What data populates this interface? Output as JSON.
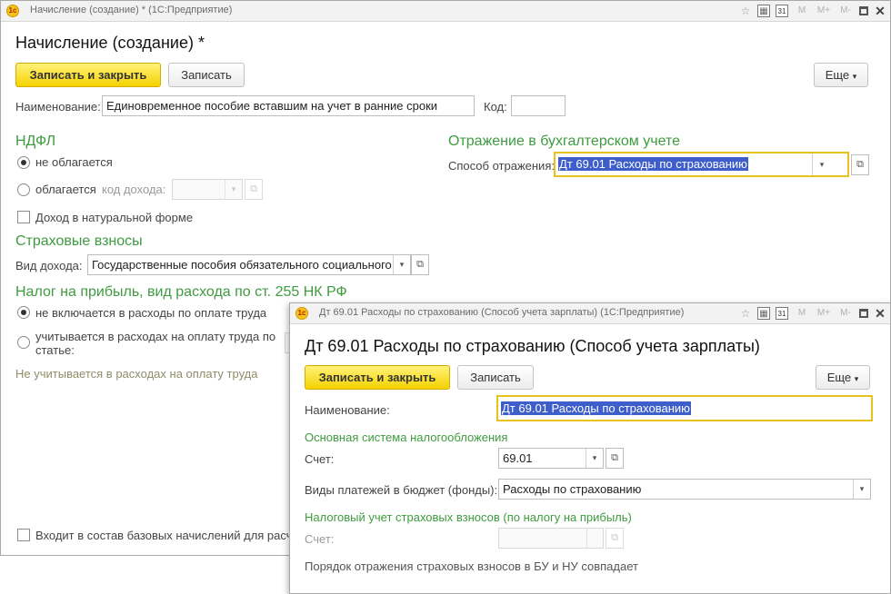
{
  "main": {
    "window_title": "Начисление (создание) * (1С:Предприятие)",
    "form_title": "Начисление (создание) *",
    "btn_save_close": "Записать и закрыть",
    "btn_save": "Записать",
    "btn_more": "Еще",
    "name_label": "Наименование:",
    "name_value": "Единовременное пособие вставшим на учет в ранние сроки",
    "code_label": "Код:",
    "code_value": "",
    "ndfl_title": "НДФЛ",
    "ndfl_opt1": "не облагается",
    "ndfl_opt2": "облагается",
    "income_code_label": "код дохода:",
    "natural_form": "Доход в натуральной форме",
    "acc_title": "Отражение в бухгалтерском учете",
    "acc_method_label": "Способ отражения:",
    "acc_method_value": "Дт 69.01 Расходы по страхованию",
    "ins_title": "Страховые взносы",
    "income_type_label": "Вид дохода:",
    "income_type_value": "Государственные пособия обязательного социального",
    "profit_title": "Налог на прибыль, вид расхода по ст. 255 НК РФ",
    "profit_opt1": "не включается в расходы по оплате труда",
    "profit_opt2_line1": "учитывается в расходах на оплату труда по",
    "profit_opt2_line2": "статье:",
    "profit_note": "Не учитывается в расходах на оплату труда",
    "base_accruals": "Входит в состав базовых начислений для расч"
  },
  "popup": {
    "window_title": "Дт 69.01 Расходы по страхованию (Способ учета зарплаты)  (1С:Предприятие)",
    "form_title": "Дт 69.01 Расходы по страхованию (Способ учета зарплаты)",
    "btn_save_close": "Записать и закрыть",
    "btn_save": "Записать",
    "btn_more": "Еще",
    "name_label": "Наименование:",
    "name_value": "Дт 69.01 Расходы по страхованию",
    "main_tax_title": "Основная система налогообложения",
    "account_label": "Счет:",
    "account_value": "69.01",
    "budget_label": "Виды платежей в бюджет (фонды):",
    "budget_value": "Расходы по страхованию",
    "tax_ins_title": "Налоговый учет страховых взносов (по налогу на прибыль)",
    "account2_label": "Счет:",
    "account2_value": "",
    "note": "Порядок отражения страховых взносов в БУ и НУ совпадает"
  },
  "toolbar": {
    "m1": "M",
    "m2": "M+",
    "m3": "M-",
    "calendar_num": "31",
    "close_glyph": "✕",
    "logo": "1c"
  },
  "colors": {
    "accent_green": "#3f9b3f",
    "primary_button": "#f5d200",
    "focus_border": "#e8c21b",
    "selection": "#3d5ecb"
  }
}
